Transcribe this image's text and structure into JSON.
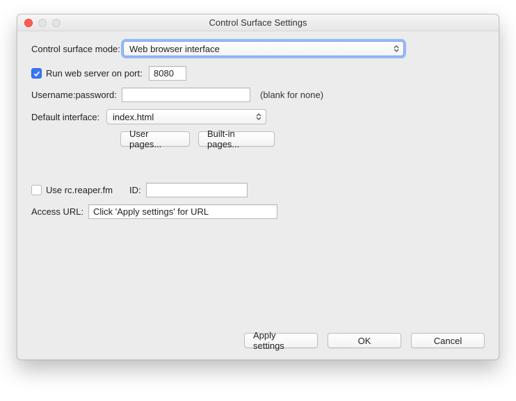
{
  "window": {
    "title": "Control Surface Settings"
  },
  "mode": {
    "label": "Control surface mode:",
    "value": "Web browser interface"
  },
  "runServer": {
    "label": "Run web server on port:",
    "checked": true,
    "portValue": "8080"
  },
  "auth": {
    "label": "Username:password:",
    "value": "",
    "hint": "(blank for none)"
  },
  "defaultInterface": {
    "label": "Default interface:",
    "value": "index.html"
  },
  "pagesButtons": {
    "user": "User pages...",
    "builtin": "Built-in pages..."
  },
  "rc": {
    "label": "Use rc.reaper.fm",
    "checked": false,
    "idLabel": "ID:",
    "idValue": ""
  },
  "accessUrl": {
    "label": "Access URL:",
    "value": "Click 'Apply settings' for URL"
  },
  "footer": {
    "apply": "Apply settings",
    "ok": "OK",
    "cancel": "Cancel"
  }
}
